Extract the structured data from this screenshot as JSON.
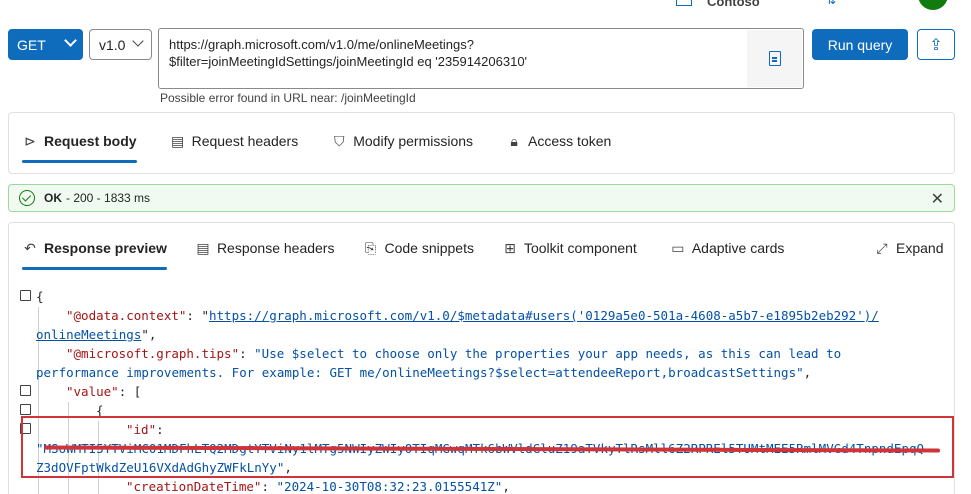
{
  "topbar": {
    "tenant": "Contoso"
  },
  "request": {
    "method": "GET",
    "version": "v1.0",
    "url_line1": "https://graph.microsoft.com/v1.0/me/onlineMeetings?",
    "url_line2": "$filter=joinMeetingIdSettings/joinMeetingId eq '235914206310'",
    "url_error": "Possible error found in URL near: /joinMeetingId",
    "run_label": "Run query"
  },
  "request_tabs": [
    "Request body",
    "Request headers",
    "Modify permissions",
    "Access token"
  ],
  "status": {
    "ok": "OK",
    "detail": " - 200 - 1833 ms"
  },
  "response_tabs": [
    "Response preview",
    "Response headers",
    "Code snippets",
    "Toolkit component",
    "Adaptive cards"
  ],
  "expand_label": "Expand",
  "json": {
    "open_brace": "{",
    "context_key": "\"@odata.context\"",
    "context_url1": "https://graph.microsoft.com/v1.0/$metadata#users('0129a5e0-501a-4608-a5b7-e1895b2eb292')/",
    "context_url2": "onlineMeetings",
    "tips_key": "\"@microsoft.graph.tips\"",
    "tips_val1": "\"Use $select to choose only the properties your app needs, as this can lead to",
    "tips_val2": "performance improvements. For example: GET me/onlineMeetings?$select=attendeeReport,broadcastSettings\"",
    "value_key": "\"value\"",
    "open_bracket": "[",
    "inner_brace": "{",
    "id_key": "\"id\"",
    "id_val1": "\"MSoWMTI5YTViMC01MDFhLTQ2MDgtYTViNy1lMTg5NWIyZWIyOTIqMGwqMTk6bWVldGluZ19aTVkyTlRsMll6Z2RPREl5TUMtMEE5RmlMVGd4TnpndEpqQ",
    "id_val2": "Z3dOVFptWkdZeU16VXdAdGhyZWFkLnYy\"",
    "created_key": "\"creationDateTime\"",
    "created_val": "\"2024-10-30T08:32:23.0155541Z\""
  }
}
